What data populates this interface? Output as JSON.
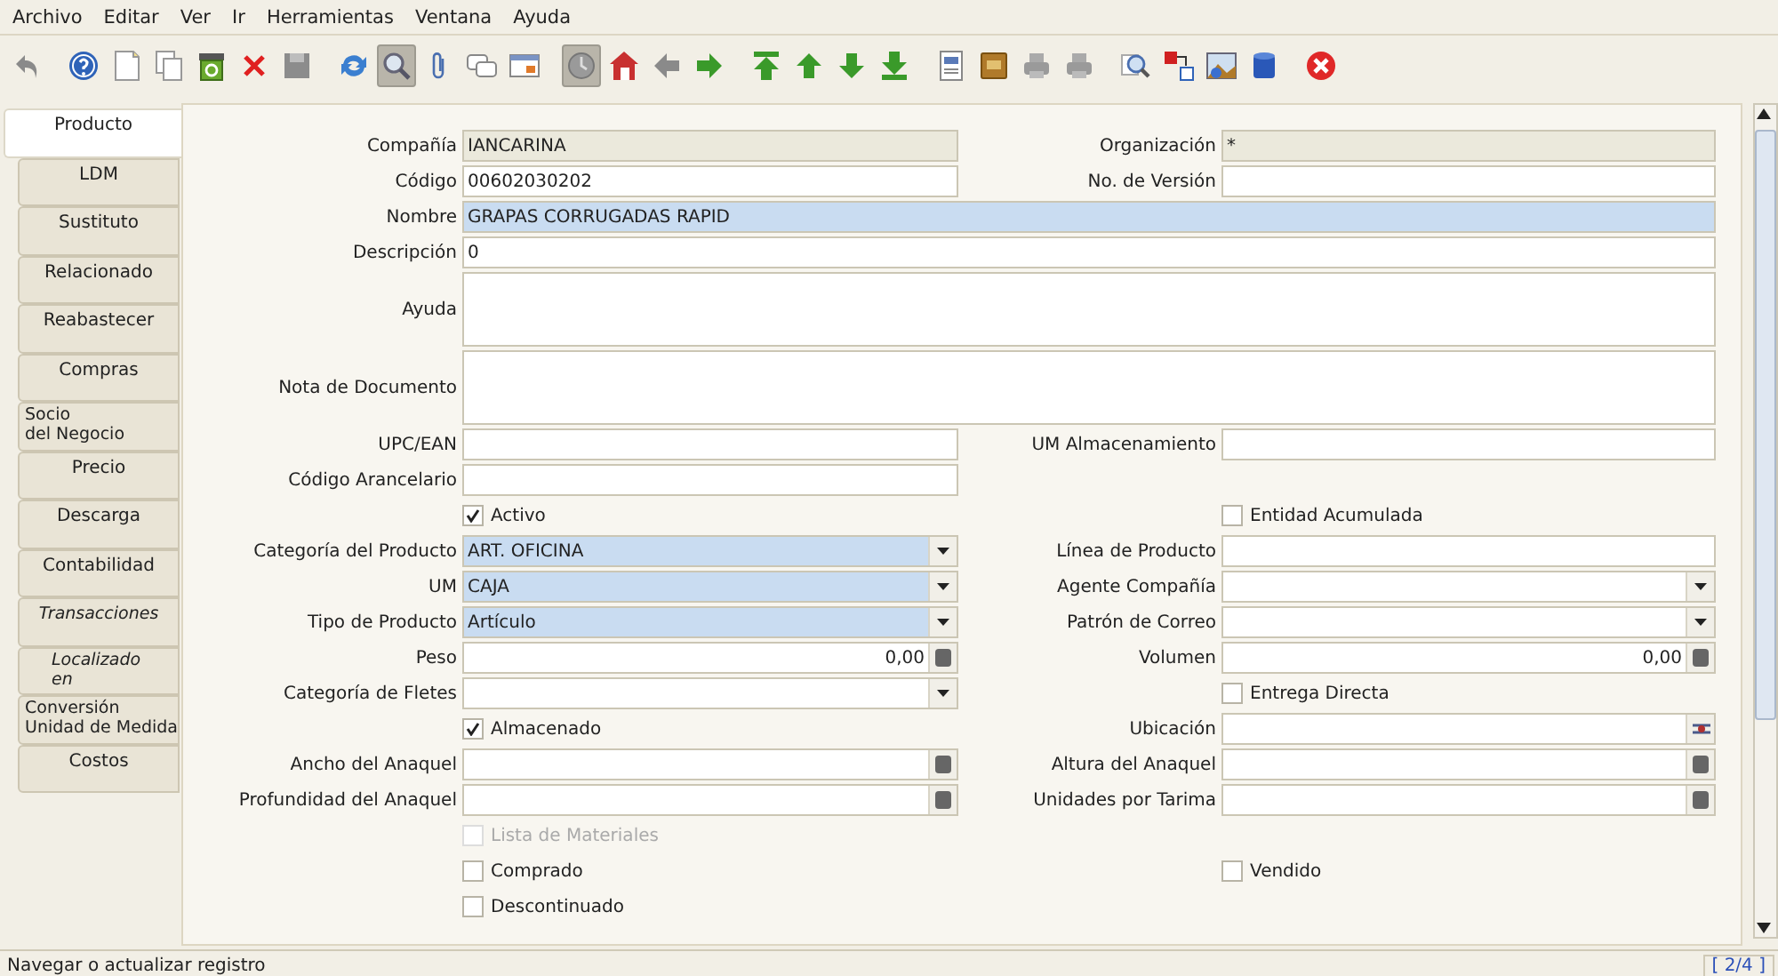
{
  "menu": [
    "Archivo",
    "Editar",
    "Ver",
    "Ir",
    "Herramientas",
    "Ventana",
    "Ayuda"
  ],
  "toolbar": [
    [
      {
        "kind": "undo",
        "pressed": false
      }
    ],
    [
      {
        "kind": "help",
        "pressed": false
      },
      {
        "kind": "new",
        "pressed": false
      },
      {
        "kind": "copy",
        "pressed": false
      },
      {
        "kind": "bin",
        "pressed": false
      },
      {
        "kind": "delete",
        "pressed": false
      },
      {
        "kind": "save",
        "pressed": false
      }
    ],
    [
      {
        "kind": "refresh",
        "pressed": false
      },
      {
        "kind": "find",
        "pressed": true
      },
      {
        "kind": "attach",
        "pressed": false
      },
      {
        "kind": "chat",
        "pressed": false
      },
      {
        "kind": "grid",
        "pressed": false
      }
    ],
    [
      {
        "kind": "history",
        "pressed": true
      },
      {
        "kind": "home",
        "pressed": false
      },
      {
        "kind": "back",
        "pressed": false
      },
      {
        "kind": "next",
        "pressed": false
      }
    ],
    [
      {
        "kind": "first",
        "pressed": false
      },
      {
        "kind": "up",
        "pressed": false
      },
      {
        "kind": "down",
        "pressed": false
      },
      {
        "kind": "last",
        "pressed": false
      }
    ],
    [
      {
        "kind": "report",
        "pressed": false
      },
      {
        "kind": "archive",
        "pressed": false
      },
      {
        "kind": "print",
        "pressed": false
      },
      {
        "kind": "print",
        "pressed": false
      }
    ],
    [
      {
        "kind": "zoom",
        "pressed": false
      },
      {
        "kind": "workflow",
        "pressed": false
      },
      {
        "kind": "image",
        "pressed": false
      },
      {
        "kind": "cylinder",
        "pressed": false
      }
    ],
    [
      {
        "kind": "close",
        "pressed": false
      }
    ]
  ],
  "tabs": [
    {
      "label": "Producto",
      "selected": true,
      "italic": false
    },
    {
      "label": "LDM",
      "selected": false,
      "italic": false
    },
    {
      "label": "Sustituto",
      "selected": false,
      "italic": false
    },
    {
      "label": "Relacionado",
      "selected": false,
      "italic": false
    },
    {
      "label": "Reabastecer",
      "selected": false,
      "italic": false
    },
    {
      "label": "Compras",
      "selected": false,
      "italic": false
    },
    {
      "label": "Socio\ndel Negocio",
      "selected": false,
      "italic": false
    },
    {
      "label": "Precio",
      "selected": false,
      "italic": false
    },
    {
      "label": "Descarga",
      "selected": false,
      "italic": false
    },
    {
      "label": "Contabilidad",
      "selected": false,
      "italic": false
    },
    {
      "label": "Transacciones",
      "selected": false,
      "italic": true
    },
    {
      "label": "Localizado\nen",
      "selected": false,
      "italic": true
    },
    {
      "label": "Conversión\nUnidad de Medida",
      "selected": false,
      "italic": false
    },
    {
      "label": "Costos",
      "selected": false,
      "italic": false
    }
  ],
  "form": [
    {
      "cells": [
        {
          "kind": "text",
          "label": "Compañía",
          "value": "IANCARINA",
          "readonly": true,
          "mandatory": false
        },
        {
          "kind": "text",
          "label": "Organización",
          "value": "*",
          "readonly": true,
          "mandatory": false
        }
      ]
    },
    {
      "cells": [
        {
          "kind": "text",
          "label": "Código",
          "value": "00602030202",
          "readonly": false,
          "mandatory": false
        },
        {
          "kind": "text",
          "label": "No. de Versión",
          "readonly": false,
          "mandatory": false
        }
      ]
    },
    {
      "cells": [
        {
          "kind": "wide-text",
          "label": "Nombre",
          "value": "GRAPAS CORRUGADAS RAPID",
          "readonly": false,
          "mandatory": true
        }
      ]
    },
    {
      "cells": [
        {
          "kind": "wide-text",
          "label": "Descripción",
          "value": "0",
          "readonly": false,
          "mandatory": false
        }
      ]
    },
    {
      "cells": [
        {
          "kind": "wide-textarea",
          "label": "Ayuda",
          "readonly": false,
          "mandatory": false
        }
      ]
    },
    {
      "cells": [
        {
          "kind": "wide-textarea",
          "label": "Nota de Documento",
          "readonly": false,
          "mandatory": false
        }
      ]
    },
    {
      "cells": [
        {
          "kind": "text",
          "label": "UPC/EAN",
          "readonly": false,
          "mandatory": false
        },
        {
          "kind": "text",
          "label": "UM Almacenamiento",
          "readonly": false,
          "mandatory": false
        }
      ]
    },
    {
      "cells": [
        {
          "kind": "text",
          "label": "Código Arancelario",
          "readonly": false,
          "mandatory": false
        },
        {
          "kind": "empty"
        }
      ]
    },
    {
      "cells": [
        {
          "kind": "checkbox",
          "label": "Activo",
          "checked": true,
          "disabled": false
        },
        {
          "kind": "checkbox",
          "label": "Entidad Acumulada",
          "checked": false,
          "disabled": false
        }
      ]
    },
    {
      "cells": [
        {
          "kind": "select",
          "label": "Categoría del Producto",
          "value": "ART. OFICINA",
          "readonly": false,
          "mandatory": true
        },
        {
          "kind": "text",
          "label": "Línea de Producto",
          "readonly": false,
          "mandatory": false
        }
      ]
    },
    {
      "cells": [
        {
          "kind": "select",
          "label": "UM",
          "value": "CAJA",
          "readonly": false,
          "mandatory": true
        },
        {
          "kind": "select",
          "label": "Agente Compañía",
          "readonly": false,
          "mandatory": false
        }
      ]
    },
    {
      "cells": [
        {
          "kind": "select",
          "label": "Tipo de Producto",
          "value": "Artículo",
          "readonly": false,
          "mandatory": true
        },
        {
          "kind": "select",
          "label": "Patrón de Correo",
          "readonly": false,
          "mandatory": false
        }
      ]
    },
    {
      "cells": [
        {
          "kind": "number",
          "label": "Peso",
          "value": "0,00",
          "readonly": false,
          "mandatory": false
        },
        {
          "kind": "number",
          "label": "Volumen",
          "value": "0,00",
          "readonly": false,
          "mandatory": false
        }
      ]
    },
    {
      "cells": [
        {
          "kind": "select",
          "label": "Categoría de Fletes",
          "readonly": false,
          "mandatory": false
        },
        {
          "kind": "checkbox",
          "label": "Entrega Directa",
          "checked": false,
          "disabled": false
        }
      ]
    },
    {
      "cells": [
        {
          "kind": "checkbox",
          "label": "Almacenado",
          "checked": true,
          "disabled": false
        },
        {
          "kind": "locator",
          "label": "Ubicación",
          "readonly": false,
          "mandatory": false
        }
      ]
    },
    {
      "cells": [
        {
          "kind": "number",
          "label": "Ancho del Anaquel",
          "readonly": false,
          "mandatory": false
        },
        {
          "kind": "number",
          "label": "Altura del Anaquel",
          "readonly": false,
          "mandatory": false
        }
      ]
    },
    {
      "cells": [
        {
          "kind": "number",
          "label": "Profundidad del Anaquel",
          "readonly": false,
          "mandatory": false
        },
        {
          "kind": "number",
          "label": "Unidades por Tarima",
          "readonly": false,
          "mandatory": false
        }
      ]
    },
    {
      "cells": [
        {
          "kind": "checkbox",
          "label": "Lista de Materiales",
          "checked": false,
          "disabled": true
        },
        {
          "kind": "empty"
        }
      ]
    },
    {
      "cells": [
        {
          "kind": "checkbox",
          "label": "Comprado",
          "checked": false,
          "disabled": false
        },
        {
          "kind": "checkbox",
          "label": "Vendido",
          "checked": false,
          "disabled": false
        }
      ]
    },
    {
      "cells": [
        {
          "kind": "checkbox",
          "label": "Descontinuado",
          "checked": false,
          "disabled": false
        },
        {
          "kind": "empty"
        }
      ]
    }
  ],
  "status_bar": {
    "message": "Navegar o actualizar registro",
    "record": "[ 2/4 ]"
  }
}
